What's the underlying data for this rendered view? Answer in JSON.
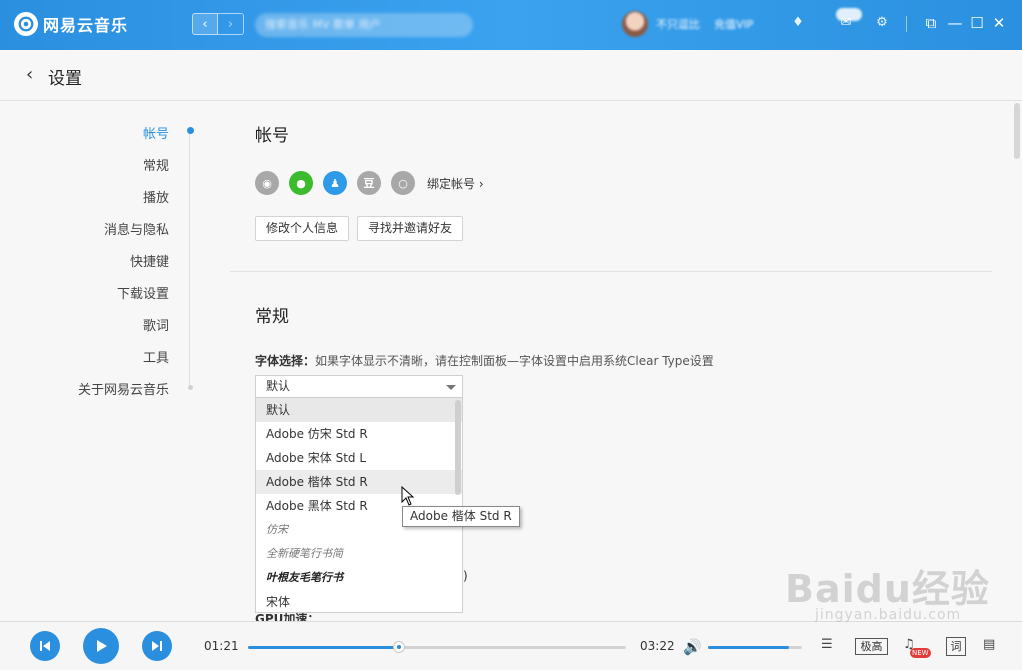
{
  "app": {
    "name": "网易云音乐"
  },
  "titlebar": {
    "search_placeholder": "搜索音乐 MV 歌单 用户",
    "username": "不只逗比",
    "vip_text": "充值VIP"
  },
  "header": {
    "title": "设置"
  },
  "sidebar": {
    "items": [
      {
        "label": "帐号"
      },
      {
        "label": "常规"
      },
      {
        "label": "播放"
      },
      {
        "label": "消息与隐私"
      },
      {
        "label": "快捷键"
      },
      {
        "label": "下载设置"
      },
      {
        "label": "歌词"
      },
      {
        "label": "工具"
      },
      {
        "label": "关于网易云音乐"
      }
    ]
  },
  "account": {
    "title": "帐号",
    "bind_link": "绑定帐号 ›",
    "edit_profile": "修改个人信息",
    "invite_friends": "寻找并邀请好友"
  },
  "general": {
    "title": "常规",
    "font_label": "字体选择：",
    "font_hint": "如果字体显示不清晰，请在控制面板—字体设置中启用系统Clear Type设置",
    "font_selected": "默认",
    "font_options": [
      "默认",
      "Adobe 仿宋 Std R",
      "Adobe 宋体 Std L",
      "Adobe 楷体 Std R",
      "Adobe 黑体 Std R",
      "仿宋",
      "全新硬笔行书简",
      "叶根友毛笔行书",
      "宋体"
    ],
    "tooltip": "Adobe 楷体 Std R",
    "paren": ")",
    "gpu_label": "GPU加速："
  },
  "player": {
    "elapsed": "01:21",
    "duration": "03:22",
    "progress": 0.4,
    "volume": 0.86,
    "quality": "极高",
    "new_badge": "NEW",
    "lyric": "词"
  },
  "watermark": {
    "main": "Baidu经验",
    "sub": "jingyan.baidu.com"
  },
  "colors": {
    "accent": "#2b8fe0",
    "titlebar": "#3aa2ef",
    "wechat": "#3dbb2f"
  }
}
